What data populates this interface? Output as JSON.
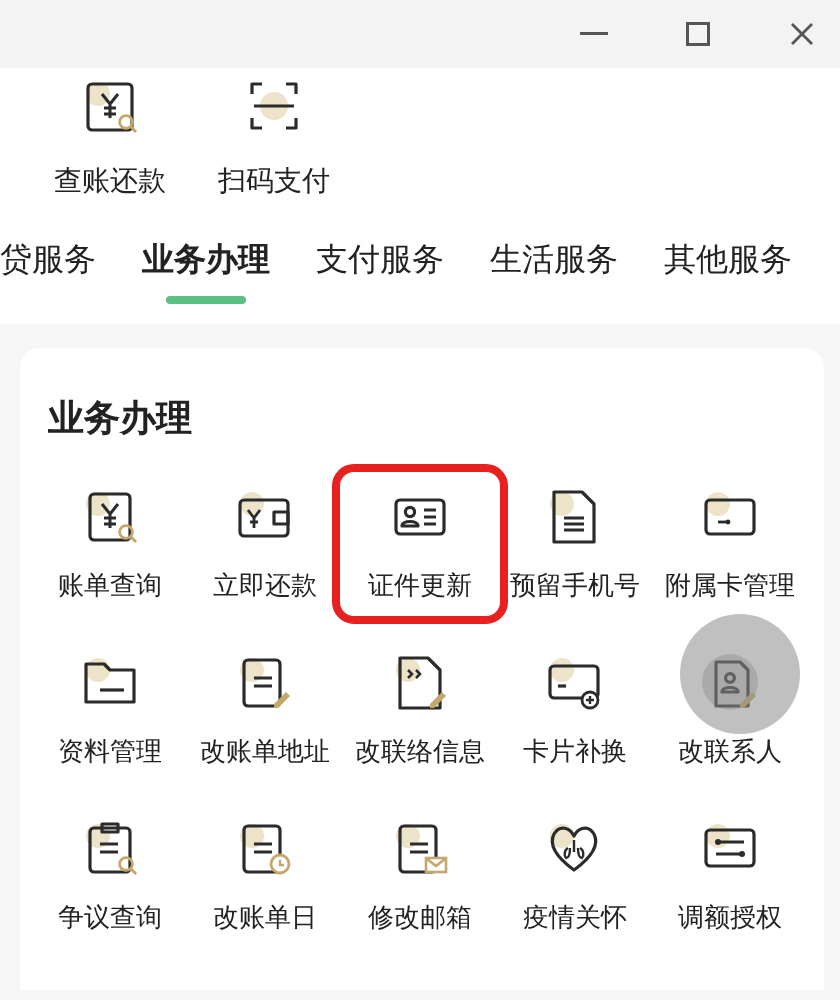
{
  "quick_actions": [
    {
      "label": "查账还款"
    },
    {
      "label": "扫码支付"
    }
  ],
  "tabs": [
    {
      "label": "贷服务",
      "selected": false
    },
    {
      "label": "业务办理",
      "selected": true
    },
    {
      "label": "支付服务",
      "selected": false
    },
    {
      "label": "生活服务",
      "selected": false
    },
    {
      "label": "其他服务",
      "selected": false
    }
  ],
  "section": {
    "title": "业务办理",
    "items": [
      {
        "label": "账单查询",
        "highlighted": false
      },
      {
        "label": "立即还款",
        "highlighted": false
      },
      {
        "label": "证件更新",
        "highlighted": true
      },
      {
        "label": "预留手机号",
        "highlighted": false
      },
      {
        "label": "附属卡管理",
        "highlighted": false
      },
      {
        "label": "资料管理",
        "highlighted": false
      },
      {
        "label": "改账单地址",
        "highlighted": false
      },
      {
        "label": "改联络信息",
        "highlighted": false
      },
      {
        "label": "卡片补换",
        "highlighted": false
      },
      {
        "label": "改联系人",
        "highlighted": false
      },
      {
        "label": "争议查询",
        "highlighted": false
      },
      {
        "label": "改账单日",
        "highlighted": false
      },
      {
        "label": "修改邮箱",
        "highlighted": false
      },
      {
        "label": "疫情关怀",
        "highlighted": false
      },
      {
        "label": "调额授权",
        "highlighted": false
      }
    ]
  }
}
